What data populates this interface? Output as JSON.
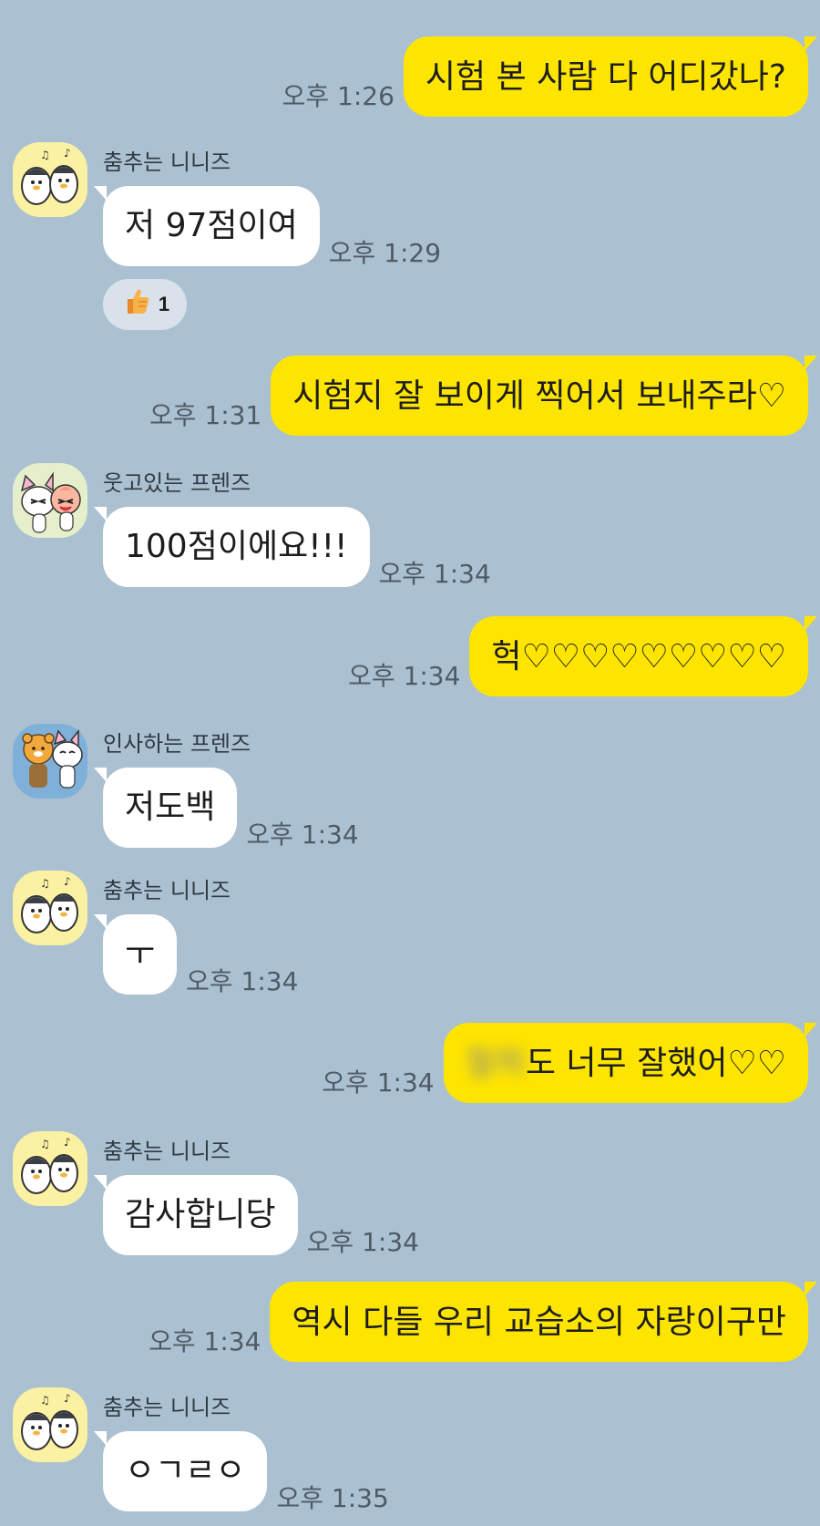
{
  "chat": {
    "messages": [
      {
        "dir": "out",
        "text": "시험 본 사람 다 어디갔나?",
        "time": "오후 1:26"
      },
      {
        "dir": "in",
        "sender": "춤추는 니니즈",
        "avatar": "ninis-dance",
        "text": "저 97점이여",
        "time": "오후 1:29",
        "reaction": {
          "emoji": "thumbs-up-icon",
          "count": "1"
        }
      },
      {
        "dir": "out",
        "text": "시험지 잘 보이게 찍어서 보내주라♡",
        "time": "오후 1:31"
      },
      {
        "dir": "in",
        "sender": "웃고있는 프렌즈",
        "avatar": "friends-laughing",
        "text": "100점이에요!!!",
        "time": "오후 1:34"
      },
      {
        "dir": "out",
        "text": "헉♡♡♡♡♡♡♡♡♡",
        "time": "오후 1:34"
      },
      {
        "dir": "in",
        "sender": "인사하는 프렌즈",
        "avatar": "friends-greeting",
        "text": "저도백",
        "time": "오후 1:34"
      },
      {
        "dir": "in",
        "sender": "춤추는 니니즈",
        "avatar": "ninis-dance",
        "text": "ㅜ",
        "time": "오후 1:34"
      },
      {
        "dir": "out",
        "blurred": "철하",
        "text": "도 너무 잘했어♡♡",
        "time": "오후 1:34"
      },
      {
        "dir": "in",
        "sender": "춤추는 니니즈",
        "avatar": "ninis-dance",
        "text": "감사합니당",
        "time": "오후 1:34"
      },
      {
        "dir": "out",
        "text": "역시 다들 우리 교습소의 자랑이구만",
        "time": "오후 1:34"
      },
      {
        "dir": "in",
        "sender": "춤추는 니니즈",
        "avatar": "ninis-dance",
        "text": "ㅇㄱㄹㅇ",
        "time": "오후 1:35"
      }
    ]
  },
  "colors": {
    "background": "#abc1d1",
    "outgoing_bubble": "#fee500",
    "incoming_bubble": "#ffffff"
  }
}
